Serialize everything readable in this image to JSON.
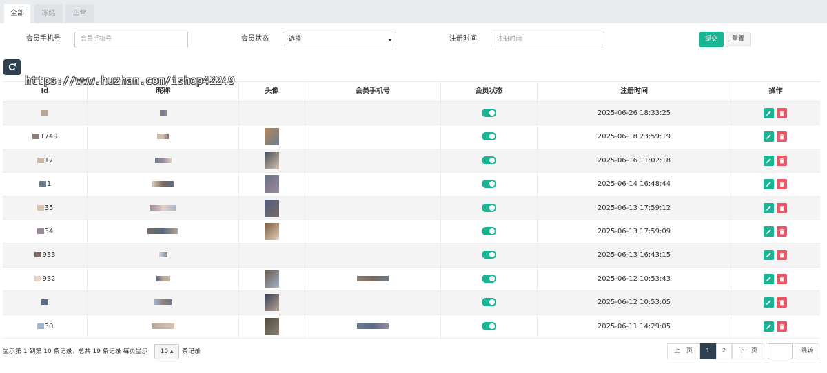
{
  "tabs": [
    "全部",
    "冻结",
    "正常"
  ],
  "filters": {
    "phone_label": "会员手机号",
    "phone_placeholder": "会员手机号",
    "status_label": "会员状态",
    "status_value": "选择",
    "time_label": "注册时间",
    "time_placeholder": "注册时间",
    "submit": "提交",
    "reset": "重置"
  },
  "watermark": "https://www.huzhan.com/ishop42249",
  "table": {
    "headers": [
      "Id",
      "昵称",
      "头像",
      "会员手机号",
      "会员状态",
      "注册时间",
      "操作"
    ],
    "rows": [
      {
        "id": "",
        "time": "2025-06-26 18:33:25",
        "status": "on"
      },
      {
        "id": "1749",
        "time": "2025-06-18 23:59:19",
        "status": "on"
      },
      {
        "id": "17",
        "time": "2025-06-16 11:02:18",
        "status": "on"
      },
      {
        "id": "1",
        "time": "2025-06-14 16:48:44",
        "status": "on"
      },
      {
        "id": "35",
        "time": "2025-06-13 17:59:12",
        "status": "on"
      },
      {
        "id": "34",
        "time": "2025-06-13 17:59:09",
        "status": "on"
      },
      {
        "id": "933",
        "time": "2025-06-13 16:43:15",
        "status": "on"
      },
      {
        "id": "932",
        "time": "2025-06-12 10:53:43",
        "status": "on"
      },
      {
        "id": "",
        "time": "2025-06-12 10:53:05",
        "status": "on"
      },
      {
        "id": "30",
        "time": "2025-06-11 14:29:05",
        "status": "on"
      }
    ]
  },
  "footer": {
    "info": "显示第 1 到第 10 条记录，总共 19 条记录 每页显示",
    "page_size": "10",
    "page_size_tail": "条记录",
    "prev": "上一页",
    "pages": [
      "1",
      "2"
    ],
    "next": "下一页",
    "jump": "跳转"
  },
  "colors": {
    "accent": "#1ab394",
    "danger": "#ed5565",
    "dark": "#2f4050"
  },
  "icons": [
    "refresh-icon",
    "pencil-icon",
    "trash-icon",
    "caret-down-icon"
  ]
}
